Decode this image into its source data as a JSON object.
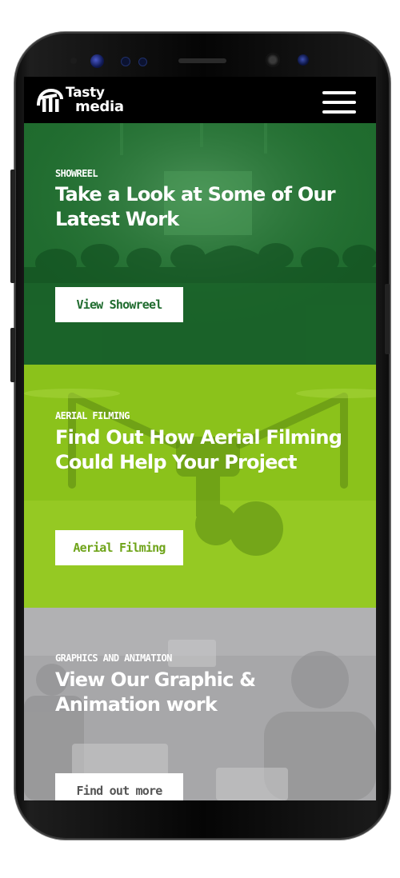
{
  "brand": {
    "logo_line1": "Tasty",
    "logo_line2": "media"
  },
  "header": {
    "menu_icon": "hamburger-menu-icon"
  },
  "sections": [
    {
      "eyebrow": "SHOWREEL",
      "headline": "Take a Look at Some of Our Latest Work",
      "button": "View Showreel",
      "background": "#1f6b2e"
    },
    {
      "eyebrow": "AERIAL FILMING",
      "headline": "Find Out How Aerial Filming Could Help Your Project",
      "button": "Aerial Filming",
      "background": "#8bc21b"
    },
    {
      "eyebrow": "GRAPHICS AND ANIMATION",
      "headline": "View Our Graphic & Animation work",
      "button": "Find out more",
      "background": "#a7a7a9"
    }
  ],
  "colors": {
    "phone_frame": "#0a0a0a",
    "showreel_green": "#1f6b2e",
    "aerial_lime": "#8bc21b",
    "graphics_grey": "#a7a7a9"
  }
}
